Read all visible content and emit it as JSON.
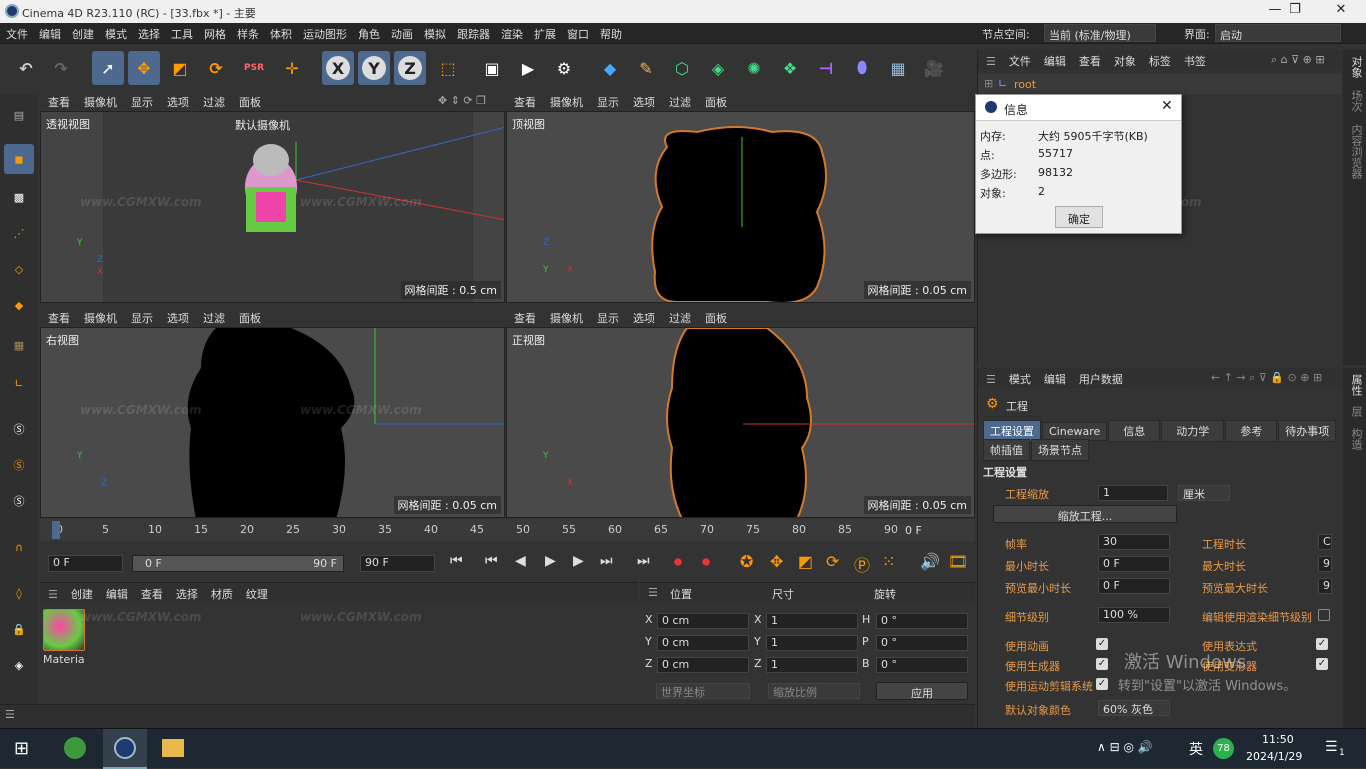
{
  "window": {
    "title": "Cinema 4D R23.110 (RC) - [33.fbx *] - 主要",
    "minimize": "—",
    "maximize": "❐",
    "close": "✕"
  },
  "menu": [
    "文件",
    "编辑",
    "创建",
    "模式",
    "选择",
    "工具",
    "网格",
    "样条",
    "体积",
    "运动图形",
    "角色",
    "动画",
    "模拟",
    "跟踪器",
    "渲染",
    "扩展",
    "窗口",
    "帮助"
  ],
  "node_space": {
    "label": "节点空间:",
    "value": "当前 (标准/物理)"
  },
  "interface": {
    "label": "界面:",
    "value": "启动"
  },
  "viewports": {
    "menu": [
      "查看",
      "摄像机",
      "显示",
      "选项",
      "过滤",
      "面板"
    ],
    "perspective": {
      "name": "透视视图",
      "camera": "默认摄像机",
      "grid": "网格间距 : 0.5 cm"
    },
    "top": {
      "name": "顶视图",
      "grid": "网格间距 : 0.05 cm"
    },
    "right": {
      "name": "右视图",
      "grid": "网格间距 : 0.05 cm"
    },
    "front": {
      "name": "正视图",
      "grid": "网格间距 : 0.05 cm"
    }
  },
  "timeline": {
    "ticks": [
      "0",
      "5",
      "10",
      "15",
      "20",
      "25",
      "30",
      "35",
      "40",
      "45",
      "50",
      "55",
      "60",
      "65",
      "70",
      "75",
      "80",
      "85",
      "90"
    ],
    "end_frame": "0 F",
    "current": "0 F",
    "range_start": "0 F",
    "range_end": "90 F",
    "max": "90 F"
  },
  "material_panel": {
    "menu": [
      "创建",
      "编辑",
      "查看",
      "选择",
      "材质",
      "纹理"
    ],
    "material_name": "Materia"
  },
  "coords": {
    "headers": [
      "位置",
      "尺寸",
      "旋转"
    ],
    "rows": [
      {
        "axis": "X",
        "pos": "0 cm",
        "size_axis": "X",
        "size": "1",
        "rot_axis": "H",
        "rot": "0 °"
      },
      {
        "axis": "Y",
        "pos": "0 cm",
        "size_axis": "Y",
        "size": "1",
        "rot_axis": "P",
        "rot": "0 °"
      },
      {
        "axis": "Z",
        "pos": "0 cm",
        "size_axis": "Z",
        "size": "1",
        "rot_axis": "B",
        "rot": "0 °"
      }
    ],
    "world": "世界坐标",
    "scale": "缩放比例",
    "apply": "应用"
  },
  "object_manager": {
    "menu": [
      "文件",
      "编辑",
      "查看",
      "对象",
      "标签",
      "书签"
    ],
    "root": "root"
  },
  "info_dialog": {
    "title": "信息",
    "rows": [
      {
        "k": "内存:",
        "v": "大约 5905千字节(KB)"
      },
      {
        "k": "点:",
        "v": "55717"
      },
      {
        "k": "多边形:",
        "v": "98132"
      },
      {
        "k": "对象:",
        "v": "2"
      }
    ],
    "ok": "确定"
  },
  "attributes": {
    "menu": [
      "模式",
      "编辑",
      "用户数据"
    ],
    "object": "工程",
    "tabs_row1": [
      "工程设置",
      "Cineware",
      "信息",
      "动力学",
      "参考",
      "待办事项"
    ],
    "tabs_row2": [
      "帧插值",
      "场景节点"
    ],
    "section": "工程设置",
    "scale_label": "工程缩放",
    "scale_value": "1",
    "scale_unit": "厘米",
    "scale_btn": "缩放工程...",
    "fps_label": "帧率",
    "fps": "30",
    "proj_time_label": "工程时长",
    "proj_time": "C",
    "min_time_label": "最小时长",
    "min_time": "0 F",
    "max_time_label": "最大时长",
    "max_time": "9",
    "prev_min_label": "预览最小时长",
    "prev_min": "0 F",
    "prev_max_label": "预览最大时长",
    "prev_max": "9",
    "lod_label": "细节级别",
    "lod": "100 %",
    "render_lod_label": "编辑使用渲染细节级别",
    "use_anim": "使用动画",
    "use_expr": "使用表达式",
    "use_gen": "使用生成器",
    "use_deform": "使用变形器",
    "use_motion": "使用运动剪辑系统",
    "default_color_label": "默认对象颜色",
    "default_color": "60% 灰色"
  },
  "right_tabs": [
    "对象",
    "场次",
    "内容浏览器"
  ],
  "right_tabs2": [
    "属性",
    "层",
    "构造"
  ],
  "activation": {
    "line1": "激活 Windows",
    "line2": "转到\"设置\"以激活 Windows。"
  },
  "taskbar": {
    "time": "11:50",
    "date": "2024/1/29",
    "ime": "英",
    "badge": "78",
    "notif": "1"
  },
  "watermark": "www.CGMXW.com"
}
